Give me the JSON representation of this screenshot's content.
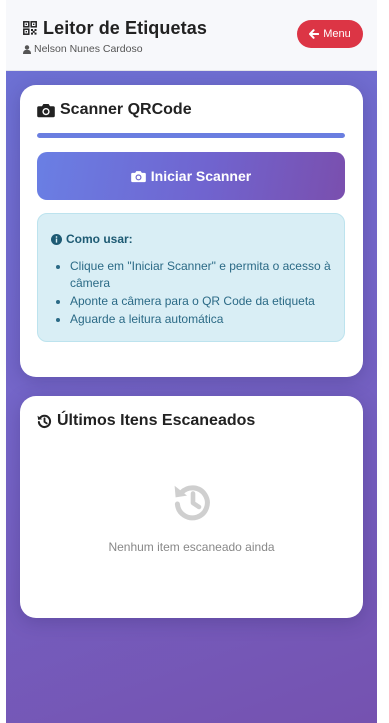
{
  "header": {
    "title": "Leitor de Etiquetas",
    "user_name": "Nelson Nunes Cardoso",
    "menu_label": "Menu"
  },
  "scanner": {
    "title": "Scanner QRCode",
    "progress": 1.0,
    "start_button_label": "Iniciar Scanner",
    "instructions": {
      "heading": "Como usar:",
      "items": [
        "Clique em \"Iniciar Scanner\" e permita o acesso à câmera",
        "Aponte a câmera para o QR Code da etiqueta",
        "Aguarde a leitura automática"
      ]
    }
  },
  "recent": {
    "title": "Últimos Itens Escaneados",
    "empty_text": "Nenhum item escaneado ainda"
  },
  "colors": {
    "menu_button": "#dc3545",
    "accent": "#6a7ee0",
    "info_background": "#d9eef5"
  },
  "icons": {
    "title": "qrcode-icon",
    "user": "user-icon",
    "menu": "arrow-left-icon",
    "scanner": "camera-icon",
    "info": "info-circle-icon",
    "recent": "history-icon"
  }
}
